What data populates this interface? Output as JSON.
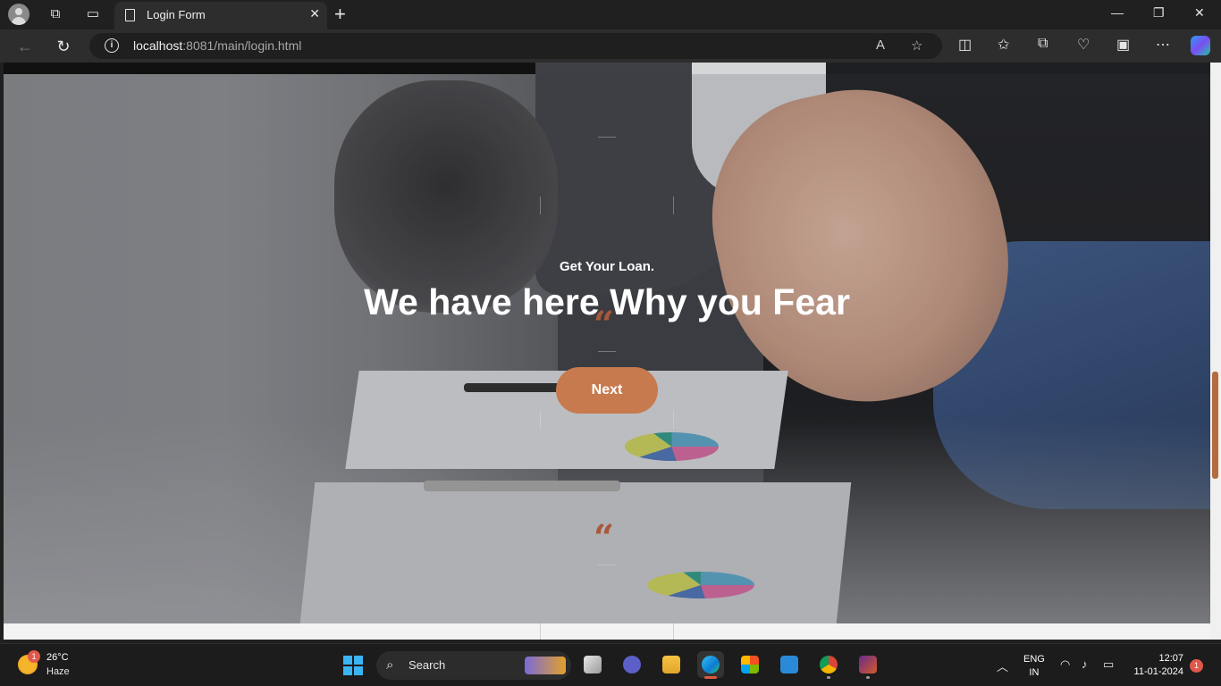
{
  "browser": {
    "tab_title": "Login Form",
    "url_host": "localhost",
    "url_path": ":8081/main/login.html"
  },
  "page": {
    "eyebrow": "Get Your Loan.",
    "headline": "We have here Why you Fear",
    "quote_mark": "“",
    "next_label": "Next"
  },
  "colors": {
    "accent": "#c77a4e",
    "quote": "#a8583a"
  },
  "taskbar": {
    "weather_badge": "1",
    "temperature": "26°C",
    "condition": "Haze",
    "search_label": "Search",
    "lang_top": "ENG",
    "lang_bottom": "IN",
    "time": "12:07",
    "date": "11-01-2024",
    "notification_count": "1"
  }
}
